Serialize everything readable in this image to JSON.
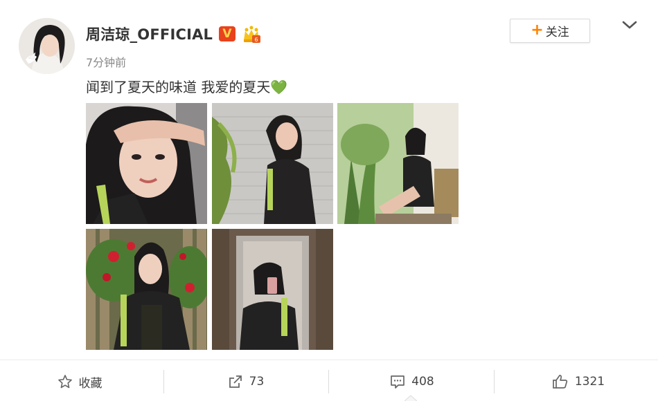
{
  "post": {
    "username": "周洁琼_OFFICIAL",
    "verified_badge": "V",
    "timestamp": "7分钟前",
    "text": "闻到了夏天的味道 我爱的夏天",
    "emoji": "💚",
    "follow_label": "关注",
    "follow_plus": "+"
  },
  "photos": [
    {
      "name": "photo-1",
      "icon": "photo-selfie-saluting"
    },
    {
      "name": "photo-2",
      "icon": "photo-brick-wall"
    },
    {
      "name": "photo-3",
      "icon": "photo-window-sitting"
    },
    {
      "name": "photo-4",
      "icon": "photo-roses-fence"
    },
    {
      "name": "photo-5",
      "icon": "photo-elevator-mirror"
    }
  ],
  "actions": {
    "favorite_label": "收藏",
    "repost_count": "73",
    "comment_count": "408",
    "like_count": "1321"
  },
  "colors": {
    "accent_orange": "#ff8200",
    "verified_red": "#e8431d",
    "text_primary": "#333333",
    "text_secondary": "#888888"
  }
}
